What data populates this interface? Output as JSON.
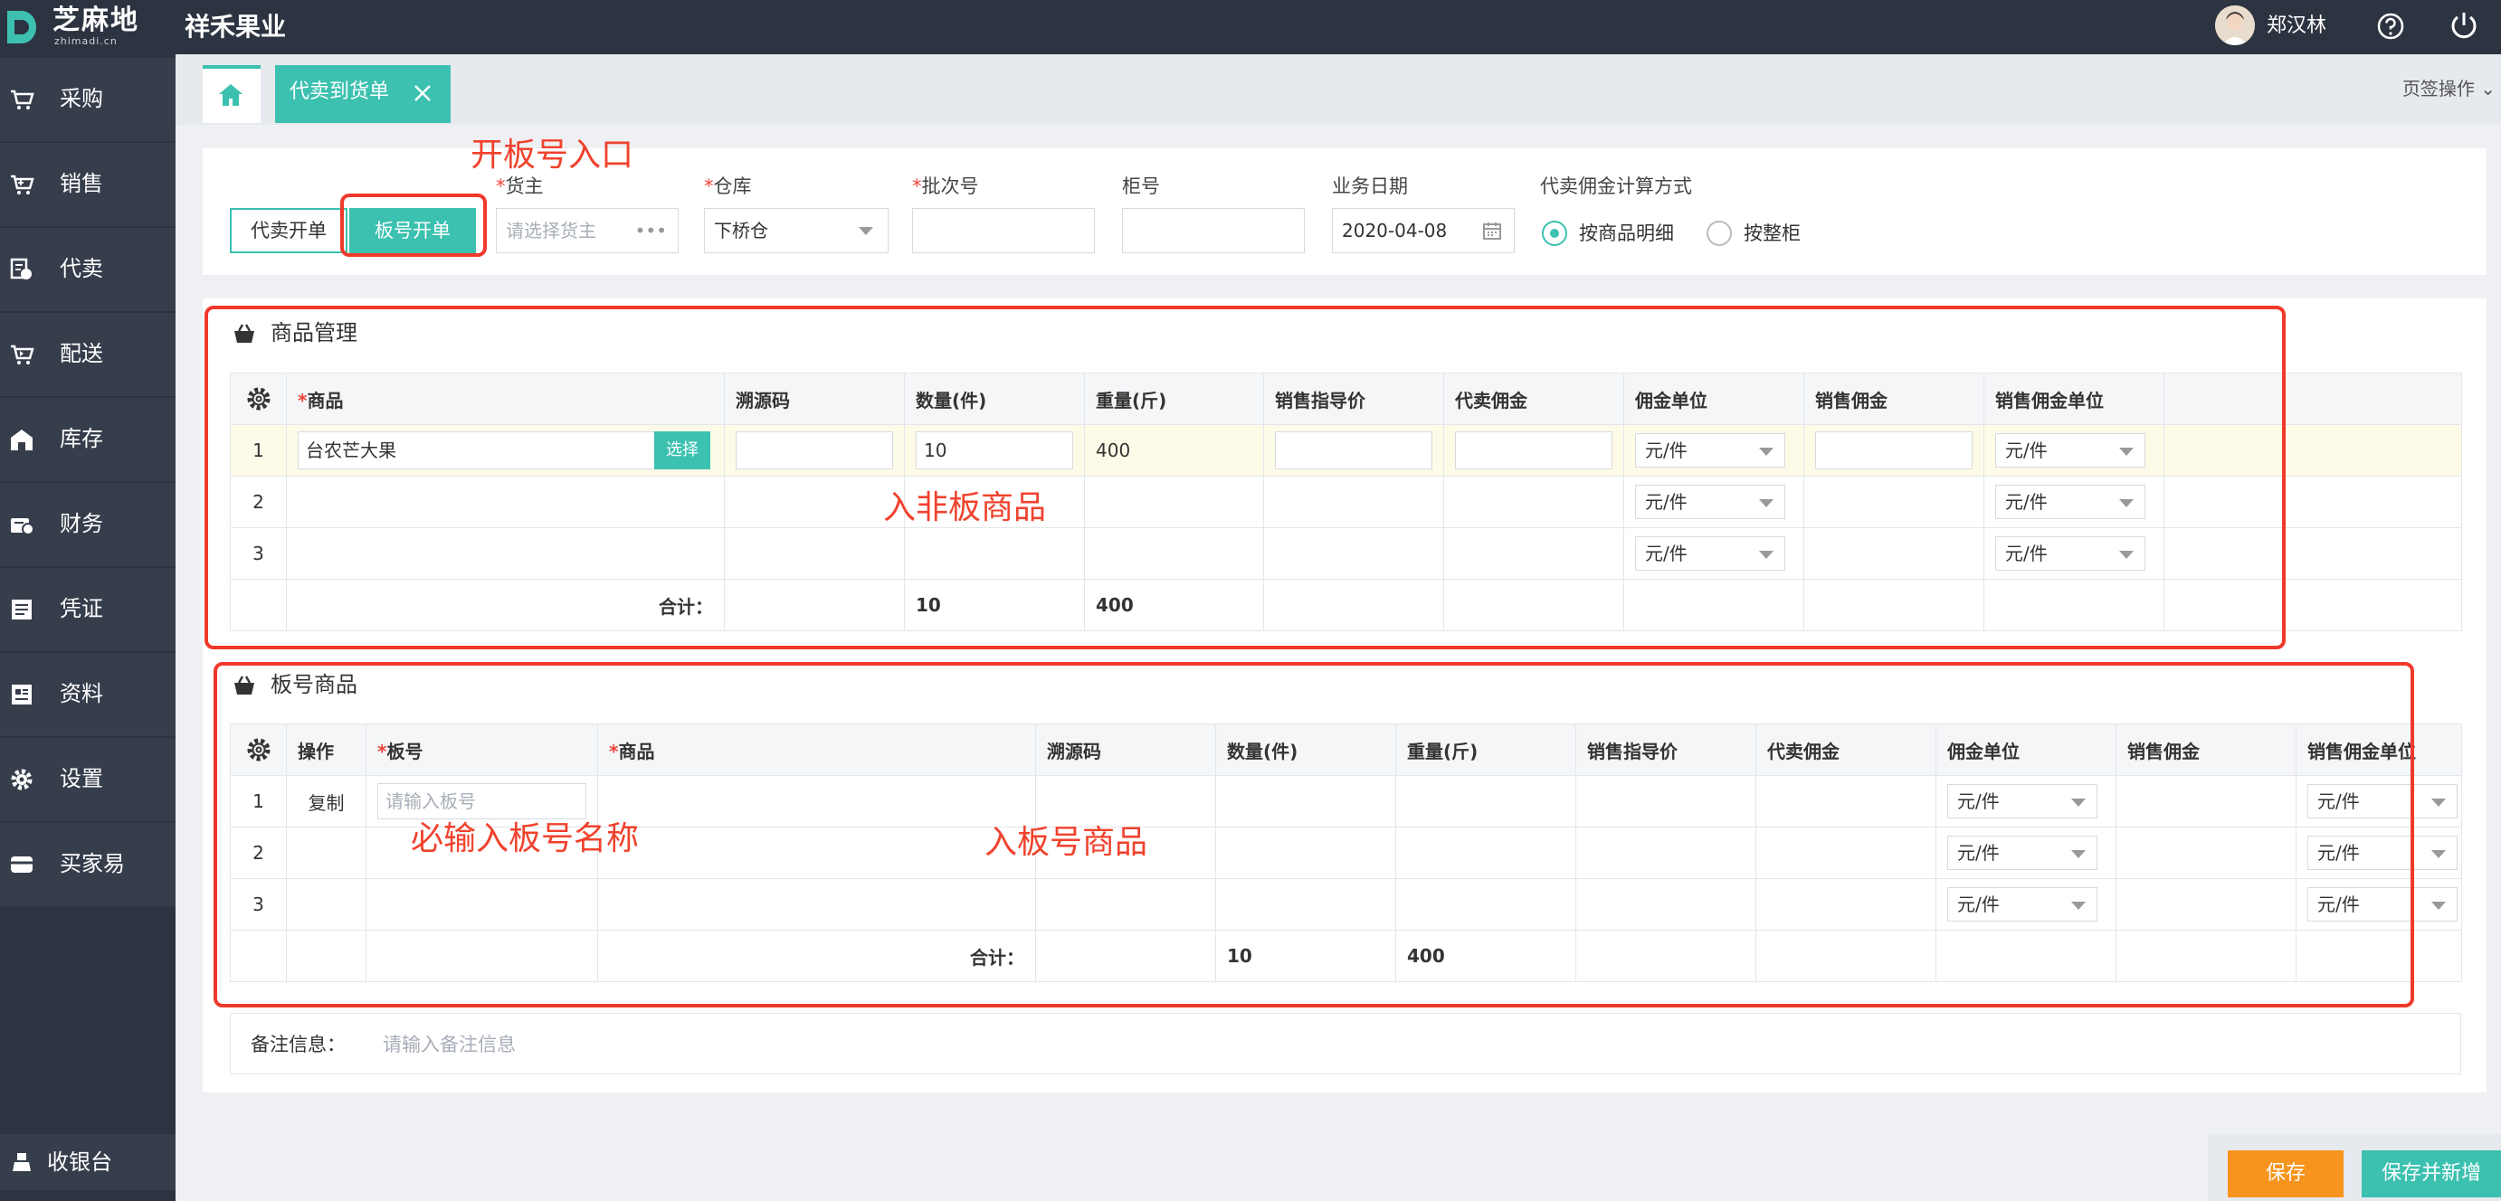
{
  "app": {
    "logo_text": "芝麻地",
    "logo_sub": "zhimadi.cn",
    "company": "祥禾果业",
    "user_name": "郑汉林"
  },
  "sidebar": {
    "items": [
      {
        "label": "采购",
        "icon": "cart-icon"
      },
      {
        "label": "销售",
        "icon": "sell-cart-icon"
      },
      {
        "label": "代卖",
        "icon": "consign-icon"
      },
      {
        "label": "配送",
        "icon": "delivery-icon"
      },
      {
        "label": "库存",
        "icon": "warehouse-icon"
      },
      {
        "label": "财务",
        "icon": "finance-icon"
      },
      {
        "label": "凭证",
        "icon": "voucher-icon"
      },
      {
        "label": "资料",
        "icon": "data-icon"
      },
      {
        "label": "设置",
        "icon": "gear-icon"
      },
      {
        "label": "买家易",
        "icon": "buyer-icon"
      }
    ],
    "cashier_label": "收银台"
  },
  "tabs": {
    "active_label": "代卖到货单",
    "page_ops": "页签操作"
  },
  "form": {
    "btn_consign": "代卖开单",
    "btn_board": "板号开单",
    "owner_label": "货主",
    "owner_placeholder": "请选择货主",
    "warehouse_label": "仓库",
    "warehouse_value": "下桥仓",
    "batch_label": "批次号",
    "cabinet_label": "柜号",
    "date_label": "业务日期",
    "date_value": "2020-04-08",
    "calc_label": "代卖佣金计算方式",
    "calc_options": [
      "按商品明细",
      "按整柜"
    ],
    "calc_selected": "按商品明细"
  },
  "goods": {
    "title": "商品管理",
    "headers": [
      "商品",
      "溯源码",
      "数量(件)",
      "重量(斤)",
      "销售指导价",
      "代卖佣金",
      "佣金单位",
      "销售佣金",
      "销售佣金单位"
    ],
    "choose_label": "选择",
    "rows": [
      {
        "no": "1",
        "product": "台农芒大果",
        "qty": "10",
        "weight": "400",
        "unit": "元/件",
        "sale_unit": "元/件"
      },
      {
        "no": "2",
        "unit": "元/件",
        "sale_unit": "元/件"
      },
      {
        "no": "3",
        "unit": "元/件",
        "sale_unit": "元/件"
      }
    ],
    "total_label": "合计：",
    "total_qty": "10",
    "total_weight": "400"
  },
  "board": {
    "title": "板号商品",
    "headers": [
      "操作",
      "板号",
      "商品",
      "溯源码",
      "数量(件)",
      "重量(斤)",
      "销售指导价",
      "代卖佣金",
      "佣金单位",
      "销售佣金",
      "销售佣金单位"
    ],
    "copy_label": "复制",
    "board_placeholder": "请输入板号",
    "rows": [
      {
        "no": "1",
        "unit": "元/件",
        "sale_unit": "元/件"
      },
      {
        "no": "2",
        "unit": "元/件",
        "sale_unit": "元/件"
      },
      {
        "no": "3",
        "unit": "元/件",
        "sale_unit": "元/件"
      }
    ],
    "total_label": "合计：",
    "total_qty": "10",
    "total_weight": "400"
  },
  "remark": {
    "label": "备注信息：",
    "placeholder": "请输入备注信息"
  },
  "annotations": {
    "board_entry": "开板号入口",
    "non_board": "入非板商品",
    "board_name": "必输入板号名称",
    "board_goods": "入板号商品"
  },
  "actions": {
    "save": "保存",
    "save_new": "保存并新增"
  },
  "colors": {
    "accent": "#3cc1b0",
    "dark": "#2d3441",
    "annotation": "#f0392b",
    "save": "#f7941d"
  }
}
